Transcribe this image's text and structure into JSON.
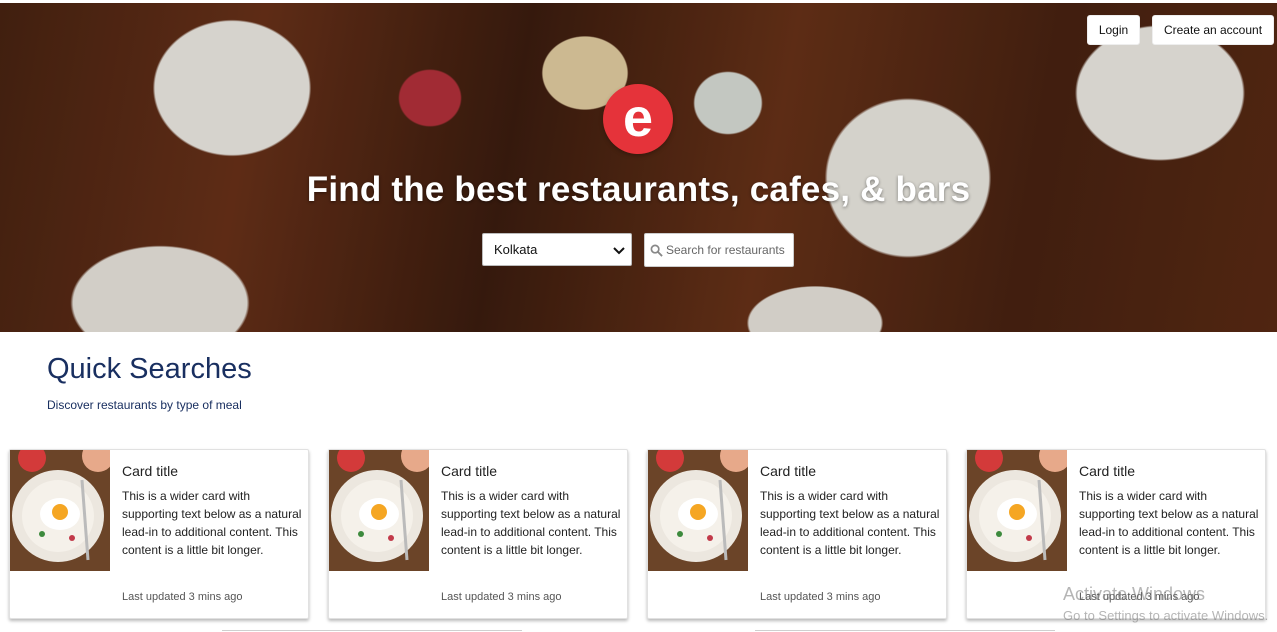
{
  "hero": {
    "title": "Find the best restaurants, cafes, & bars",
    "logo_letter": "e",
    "location_select": {
      "value": "Kolkata"
    },
    "search": {
      "placeholder": "Search for restaurants"
    },
    "login_label": "Login",
    "create_account_label": "Create an account"
  },
  "quick_searches": {
    "title": "Quick Searches",
    "subtitle": "Discover restaurants by type of meal",
    "cards": [
      {
        "title": "Card title",
        "text": "This is a wider card with supporting text below as a natural lead-in to additional content. This content is a little bit longer.",
        "meta": "Last updated 3 mins ago"
      },
      {
        "title": "Card title",
        "text": "This is a wider card with supporting text below as a natural lead-in to additional content. This content is a little bit longer.",
        "meta": "Last updated 3 mins ago"
      },
      {
        "title": "Card title",
        "text": "This is a wider card with supporting text below as a natural lead-in to additional content. This content is a little bit longer.",
        "meta": "Last updated 3 mins ago"
      },
      {
        "title": "Card title",
        "text": "This is a wider card with supporting text below as a natural lead-in to additional content. This content is a little bit longer.",
        "meta": "Last updated 3 mins ago"
      }
    ]
  },
  "os_watermark": {
    "line1": "Activate Windows",
    "line2": "Go to Settings to activate Windows."
  },
  "colors": {
    "brand_red": "#e5333a",
    "heading_navy": "#192f60"
  },
  "icons": {
    "search": "search-icon",
    "dropdown": "chevron-down-icon",
    "logo": "brand-logo-icon"
  }
}
